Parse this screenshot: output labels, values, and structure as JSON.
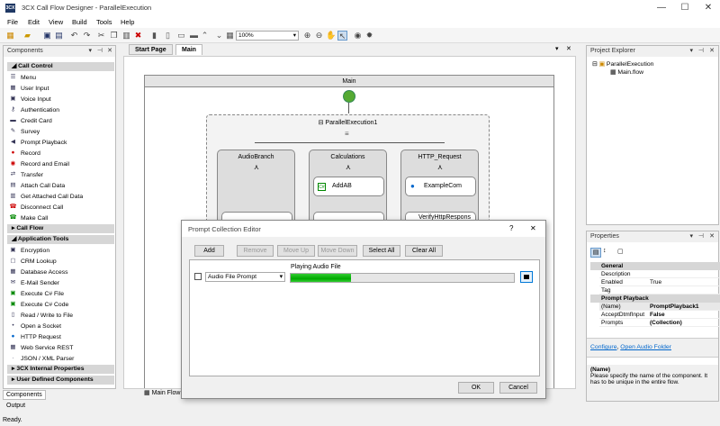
{
  "window": {
    "title": "3CX Call Flow Designer - ParallelExecution",
    "icon_label": "3CX",
    "min_icon": "—",
    "max_icon": "☐",
    "close_icon": "✕"
  },
  "menu": [
    "File",
    "Edit",
    "View",
    "Build",
    "Tools",
    "Help"
  ],
  "toolbar": {
    "zoom": "100%"
  },
  "components": {
    "title": "Components",
    "categories": [
      {
        "label": "Call Control",
        "items": [
          "Menu",
          "User Input",
          "Voice Input",
          "Authentication",
          "Credit Card",
          "Survey",
          "Prompt Playback",
          "Record",
          "Record and Email",
          "Transfer",
          "Attach Call Data",
          "Get Attached Call Data",
          "Disconnect Call",
          "Make Call"
        ]
      },
      {
        "label": "Call Flow",
        "items": []
      },
      {
        "label": "Application Tools",
        "items": [
          "Encryption",
          "CRM Lookup",
          "Database Access",
          "E-Mail Sender",
          "Execute C# File",
          "Execute C# Code",
          "Read / Write to File",
          "Open a Socket",
          "HTTP Request",
          "Web Service REST",
          "JSON / XML Parser"
        ]
      },
      {
        "label": "3CX Internal Properties",
        "items": []
      },
      {
        "label": "User Defined Components",
        "items": []
      }
    ],
    "bottom_tab": "Components",
    "output_tab": "Output"
  },
  "doc_tabs": [
    "Start Page",
    "Main"
  ],
  "canvas": {
    "main_title": "Main",
    "parallel_label": "ParallelExecution1",
    "branches": [
      {
        "label": "AudioBranch",
        "block": ""
      },
      {
        "label": "Calculations",
        "block": "AddAB"
      },
      {
        "label": "HTTP_Request",
        "block": "ExampleCom",
        "block2": "VerifyHttpRespons"
      }
    ],
    "bottom_tab": "Main Flow"
  },
  "dialog": {
    "title": "Prompt Collection Editor",
    "help": "?",
    "close": "✕",
    "buttons": [
      "Add",
      "Remove",
      "Move Up",
      "Move Down",
      "Select All",
      "Clear All"
    ],
    "prompt_type": "Audio File Prompt",
    "status_label": "Playing Audio File",
    "progress": 0.27,
    "ok": "OK",
    "cancel": "Cancel"
  },
  "project_explorer": {
    "title": "Project Explorer",
    "root": "ParallelExecution",
    "child": "Main.flow"
  },
  "properties": {
    "title": "Properties",
    "general": "General",
    "general_rows": [
      [
        "Description",
        ""
      ],
      [
        "Enabled",
        "True"
      ],
      [
        "Tag",
        ""
      ]
    ],
    "playback": "Prompt Playback",
    "playback_rows": [
      [
        "(Name)",
        "PromptPlayback1"
      ],
      [
        "AcceptDtmfInput",
        "False"
      ],
      [
        "Prompts",
        "(Collection)"
      ]
    ],
    "link1": "Configure",
    "link2": "Open Audio Folder",
    "desc_title": "(Name)",
    "desc_text": "Please specify the name of the component. It has to be unique in the entire flow."
  },
  "status": "Ready."
}
